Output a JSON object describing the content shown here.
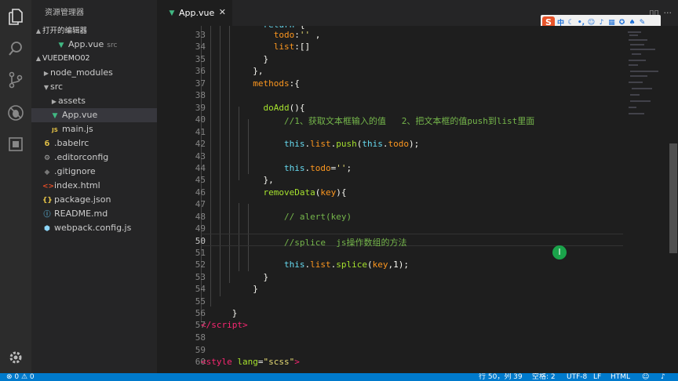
{
  "sidebar": {
    "title": "资源管理器",
    "open_editors_label": "打开的编辑器",
    "open_editor": {
      "name": "App.vue",
      "path": "src"
    },
    "project_label": "VUEDEMO02",
    "tree": [
      {
        "label": "node_modules",
        "kind": "folder"
      },
      {
        "label": "src",
        "kind": "folder"
      },
      {
        "label": "assets",
        "kind": "folder"
      },
      {
        "label": "App.vue",
        "kind": "vue"
      },
      {
        "label": "main.js",
        "kind": "js"
      },
      {
        "label": ".babelrc",
        "kind": "babel"
      },
      {
        "label": ".editorconfig",
        "kind": "gear"
      },
      {
        "label": ".gitignore",
        "kind": "git"
      },
      {
        "label": "index.html",
        "kind": "html"
      },
      {
        "label": "package.json",
        "kind": "json"
      },
      {
        "label": "README.md",
        "kind": "info"
      },
      {
        "label": "webpack.config.js",
        "kind": "webpack"
      }
    ]
  },
  "tab": {
    "title": "App.vue"
  },
  "ime_toolbar": {
    "mode_label": "中"
  },
  "editor": {
    "line_numbers": [
      "33",
      "34",
      "35",
      "36",
      "37",
      "38",
      "39",
      "40",
      "41",
      "42",
      "43",
      "44",
      "45",
      "46",
      "47",
      "48",
      "49",
      "50",
      "51",
      "52",
      "53",
      "54",
      "55",
      "56",
      "57",
      "58",
      "59",
      "60"
    ],
    "comment_line_40": "//1、获取文本框输入的值   2、把文本框的值push到list里面",
    "comment_line_48": "// alert(key)",
    "comment_line_50": "//splice  js操作数组的方法"
  },
  "status": {
    "problems": "⊗ 0  ⚠ 0",
    "position": "行 50，列 39",
    "spaces": "空格: 2",
    "encoding": "UTF-8",
    "eol": "LF",
    "language": "HTML"
  }
}
